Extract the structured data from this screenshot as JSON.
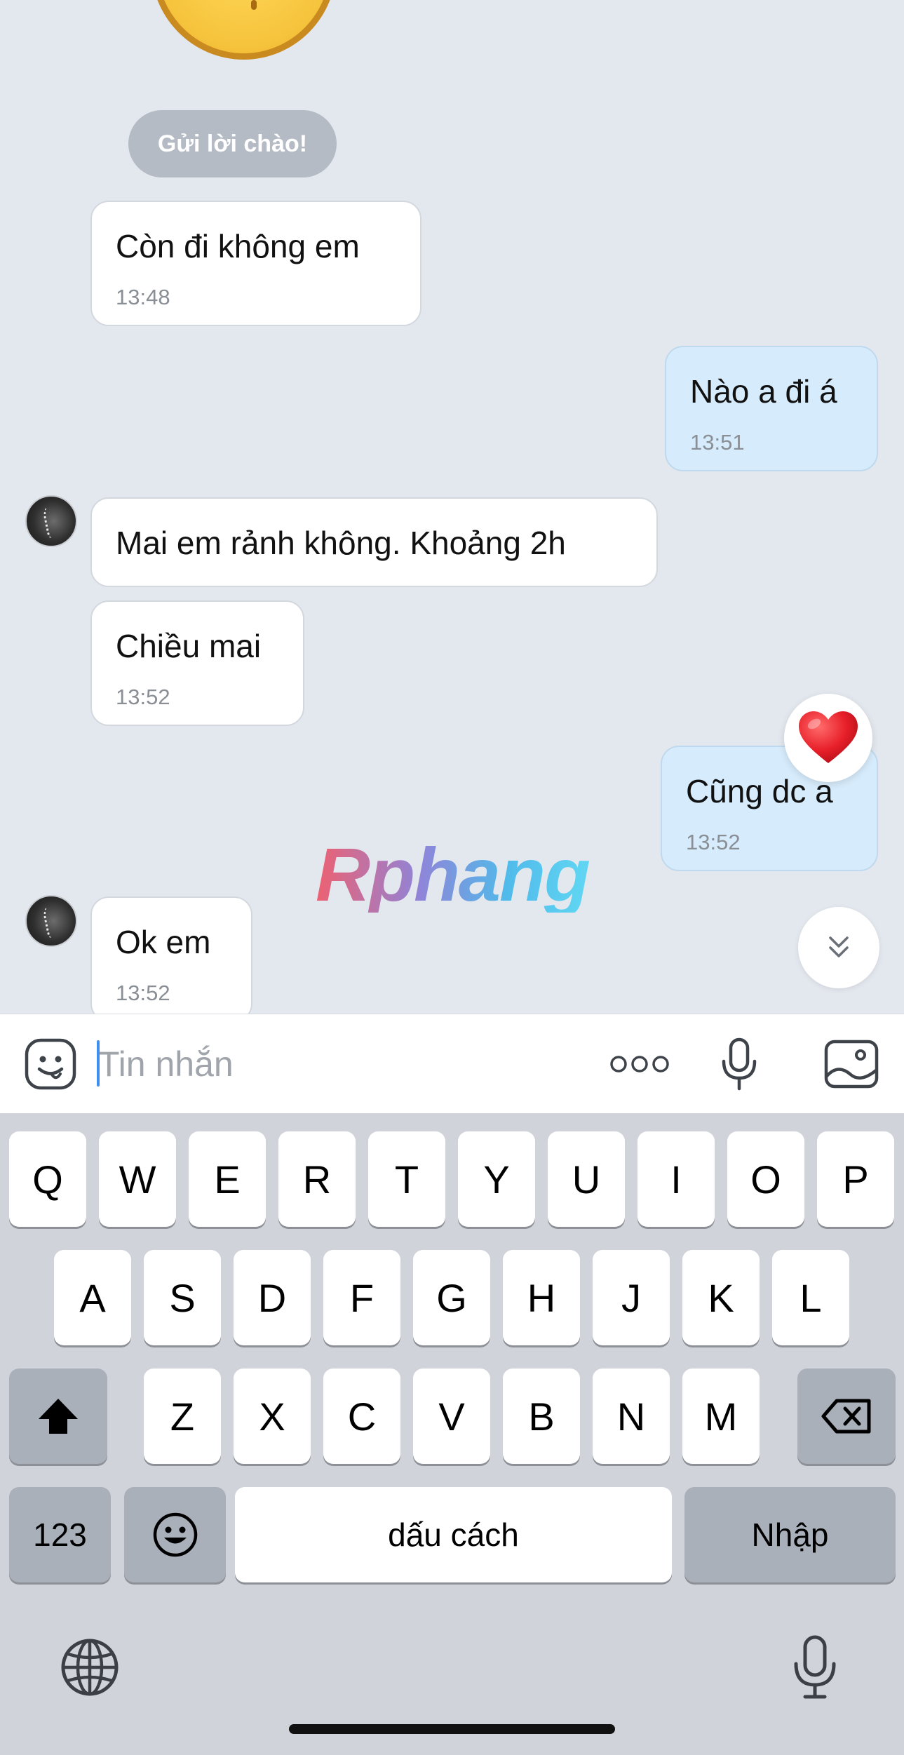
{
  "chat": {
    "greet_button": "Gửi lời chào!",
    "messages": [
      {
        "side": "in",
        "text": "Còn đi không em",
        "time": "13:48"
      },
      {
        "side": "out",
        "text": "Nào a đi á",
        "time": "13:51"
      },
      {
        "side": "in",
        "text": "Mai em rảnh không. Khoảng 2h",
        "time": ""
      },
      {
        "side": "in",
        "text": "Chiều mai",
        "time": "13:52"
      },
      {
        "side": "out",
        "text": "Cũng dc a",
        "time": "13:52",
        "reaction": "heart"
      },
      {
        "side": "in",
        "text": "Ok em",
        "time": "13:52"
      }
    ],
    "watermark": "Rphang",
    "scroll_down_icon": "double-chevron-down-icon"
  },
  "input_bar": {
    "placeholder": "Tin nhắn",
    "icons": [
      "sticker-icon",
      "more-icon",
      "microphone-icon",
      "image-icon"
    ]
  },
  "keyboard": {
    "row1": [
      "Q",
      "W",
      "E",
      "R",
      "T",
      "Y",
      "U",
      "I",
      "O",
      "P"
    ],
    "row2": [
      "A",
      "S",
      "D",
      "F",
      "G",
      "H",
      "J",
      "K",
      "L"
    ],
    "row3": [
      "Z",
      "X",
      "C",
      "V",
      "B",
      "N",
      "M"
    ],
    "numbers_key": "123",
    "space_key": "dấu cách",
    "return_key": "Nhập",
    "icons": [
      "shift-icon",
      "backspace-icon",
      "emoji-icon",
      "globe-icon",
      "dictation-icon"
    ]
  },
  "colors": {
    "chat_background": "#e3e7ee",
    "incoming_bubble": "#ffffff",
    "outgoing_bubble": "#d6ebfb",
    "accent": "#3d8ef0",
    "keyboard_background": "#d0d3d9"
  }
}
